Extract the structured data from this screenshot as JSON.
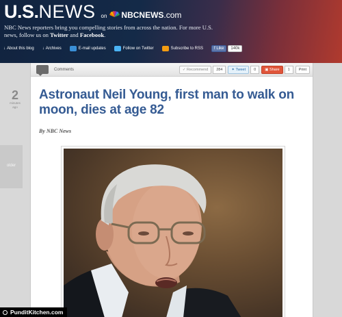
{
  "header": {
    "brand_us": "U.S.",
    "brand_news": "NEWS",
    "brand_on": "on",
    "brand_nbc": "NBCNEWS",
    "brand_nbc_suffix": ".com",
    "blurb_line1": "NBC News reporters bring you compelling stories from across the nation. For more U.S.",
    "blurb_line2_prefix": "news, follow us on ",
    "blurb_twitter": "Twitter",
    "blurb_and": " and ",
    "blurb_facebook": "Facebook",
    "blurb_end": ".",
    "nav": [
      {
        "label": "About this blog",
        "icon": "arrow-down-icon"
      },
      {
        "label": "Archives",
        "icon": "arrow-down-icon"
      },
      {
        "label": "E-mail updates",
        "icon": "email-icon"
      },
      {
        "label": "Follow on Twitter",
        "icon": "twitter-icon"
      },
      {
        "label": "Subscribe to RSS",
        "icon": "rss-icon"
      }
    ],
    "fb_like_label": "Like",
    "fb_like_count": "140k"
  },
  "toolbar": {
    "comments_label": "Comments",
    "recommend_label": "Recommend",
    "recommend_count": "284",
    "tweet_label": "Tweet",
    "tweet_count": "0",
    "share_label": "Share",
    "share_count": "1",
    "print_label": "Print"
  },
  "article": {
    "time_number": "2",
    "time_unit": "minutes",
    "time_ago": "ago",
    "title": "Astronaut Neil Young, first man to walk on moon, dies at age 82",
    "byline": "By NBC News",
    "older_label": "older"
  },
  "watermark": {
    "text": "PunditKitchen.com"
  },
  "colors": {
    "title_blue": "#355b93",
    "share_red": "#e0553a",
    "facebook_blue": "#3b5998"
  }
}
